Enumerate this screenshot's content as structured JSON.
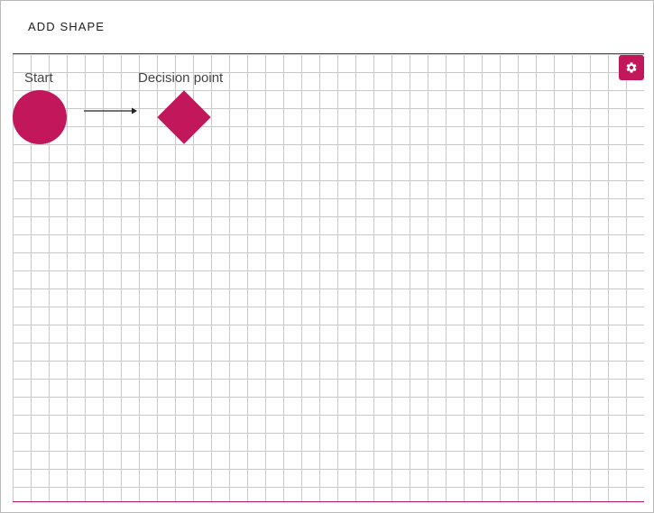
{
  "toolbar": {
    "add_shape_label": "ADD SHAPE"
  },
  "canvas": {
    "settings_icon": "gear-icon",
    "nodes": [
      {
        "type": "circle",
        "label": "Start",
        "color": "#c2185b"
      },
      {
        "type": "diamond",
        "label": "Decision point",
        "color": "#c2185b"
      }
    ],
    "connector_icon": "arrow-right-icon"
  },
  "colors": {
    "accent": "#c2185b",
    "grid": "#c9c9c9"
  }
}
